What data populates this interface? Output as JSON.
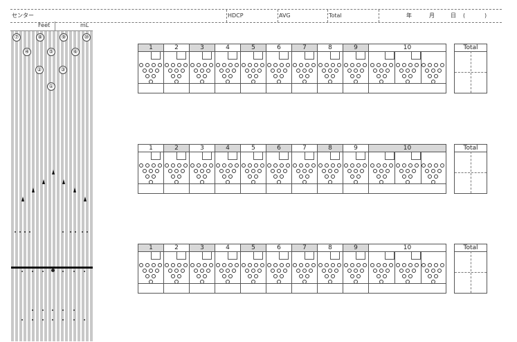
{
  "header": {
    "center_label": "センター",
    "hdcp_label": "HDCP",
    "avg_label": "AVG",
    "total_label": "Total",
    "date_year": "年",
    "date_month": "月",
    "date_day": "日",
    "date_paren_open": "(",
    "date_paren_close": ")"
  },
  "lane": {
    "feet_label": "Feet",
    "ml_label": "mL",
    "pin_spots": [
      "⑦",
      "⑧",
      "⑨",
      "⑩",
      "④",
      "⑤",
      "⑥",
      "②",
      "③",
      "①"
    ]
  },
  "scoresheets": [
    {
      "frames": [
        "1",
        "2",
        "3",
        "4",
        "5",
        "6",
        "7",
        "8",
        "9",
        "10"
      ],
      "total_label": "Total",
      "shaded": [
        true,
        false,
        true,
        false,
        true,
        false,
        true,
        false,
        true,
        false
      ]
    },
    {
      "frames": [
        "1",
        "2",
        "3",
        "4",
        "5",
        "6",
        "7",
        "8",
        "9",
        "10"
      ],
      "total_label": "Total",
      "shaded": [
        false,
        true,
        false,
        true,
        false,
        true,
        false,
        true,
        false,
        true
      ]
    },
    {
      "frames": [
        "1",
        "2",
        "3",
        "4",
        "5",
        "6",
        "7",
        "8",
        "9",
        "10"
      ],
      "total_label": "Total",
      "shaded": [
        true,
        false,
        true,
        false,
        true,
        false,
        true,
        false,
        true,
        false
      ]
    }
  ]
}
